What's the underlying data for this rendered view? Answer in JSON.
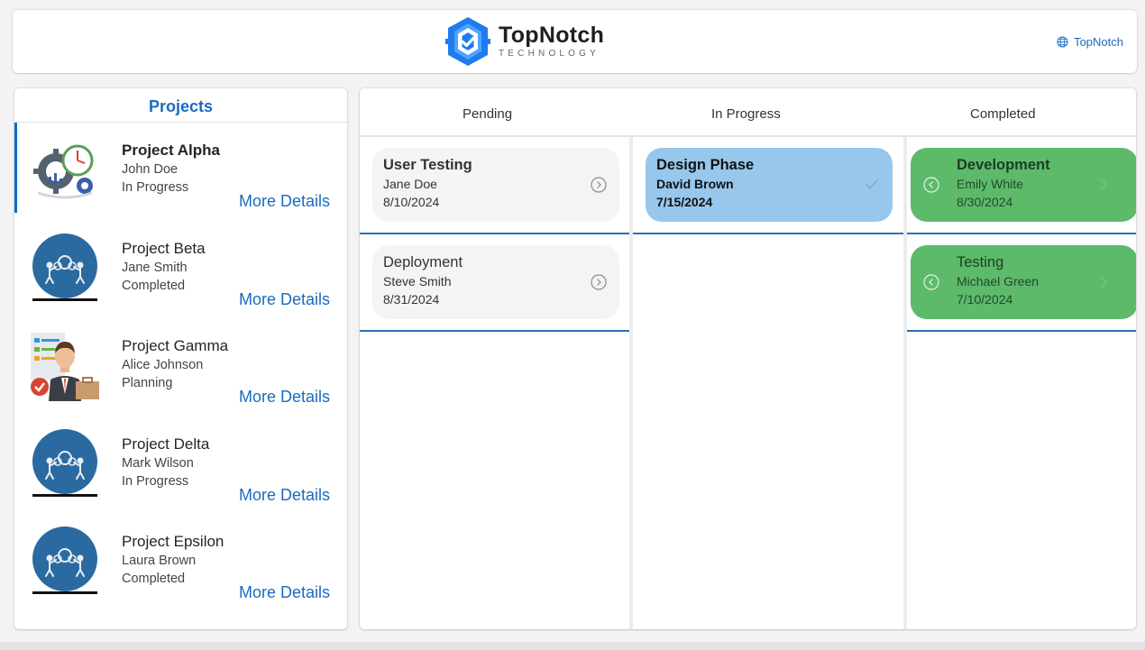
{
  "header": {
    "logo_name": "TopNotch",
    "logo_sub": "TECHNOLOGY",
    "link_label": "TopNotch",
    "brand_color": "#1a6bc0",
    "logo_colors": [
      "#1e7cf0",
      "#4fa3ff"
    ]
  },
  "projects": {
    "title": "Projects",
    "items": [
      {
        "name": "Project Alpha",
        "owner": "John Doe",
        "status": "In Progress",
        "more": "More Details",
        "icon": "gears-clock-icon",
        "active": true
      },
      {
        "name": "Project Beta",
        "owner": "Jane Smith",
        "status": "Completed",
        "more": "More Details",
        "icon": "team-gears-icon"
      },
      {
        "name": "Project Gamma",
        "owner": "Alice Johnson",
        "status": "Planning",
        "more": "More Details",
        "icon": "businessman-icon"
      },
      {
        "name": "Project Delta",
        "owner": "Mark Wilson",
        "status": "In Progress",
        "more": "More Details",
        "icon": "team-gears-icon"
      },
      {
        "name": "Project Epsilon",
        "owner": "Laura Brown",
        "status": "Completed",
        "more": "More Details",
        "icon": "team-gears-icon"
      }
    ]
  },
  "board": {
    "columns": [
      "Pending",
      "In Progress",
      "Completed"
    ],
    "pending": [
      {
        "title": "User Testing",
        "person": "Jane Doe",
        "date": "8/10/2024"
      },
      {
        "title": "Deployment",
        "person": "Steve Smith",
        "date": "8/31/2024"
      }
    ],
    "in_progress": [
      {
        "title": "Design Phase",
        "person": "David Brown",
        "date": "7/15/2024"
      }
    ],
    "completed": [
      {
        "title": "Development",
        "person": "Emily White",
        "date": "8/30/2024"
      },
      {
        "title": "Testing",
        "person": "Michael Green",
        "date": "7/10/2024"
      }
    ],
    "colors": {
      "pending": "#f4f4f4",
      "in_progress": "#97c7ec",
      "completed": "#5dba6b",
      "divider": "#2f6fb5"
    }
  }
}
